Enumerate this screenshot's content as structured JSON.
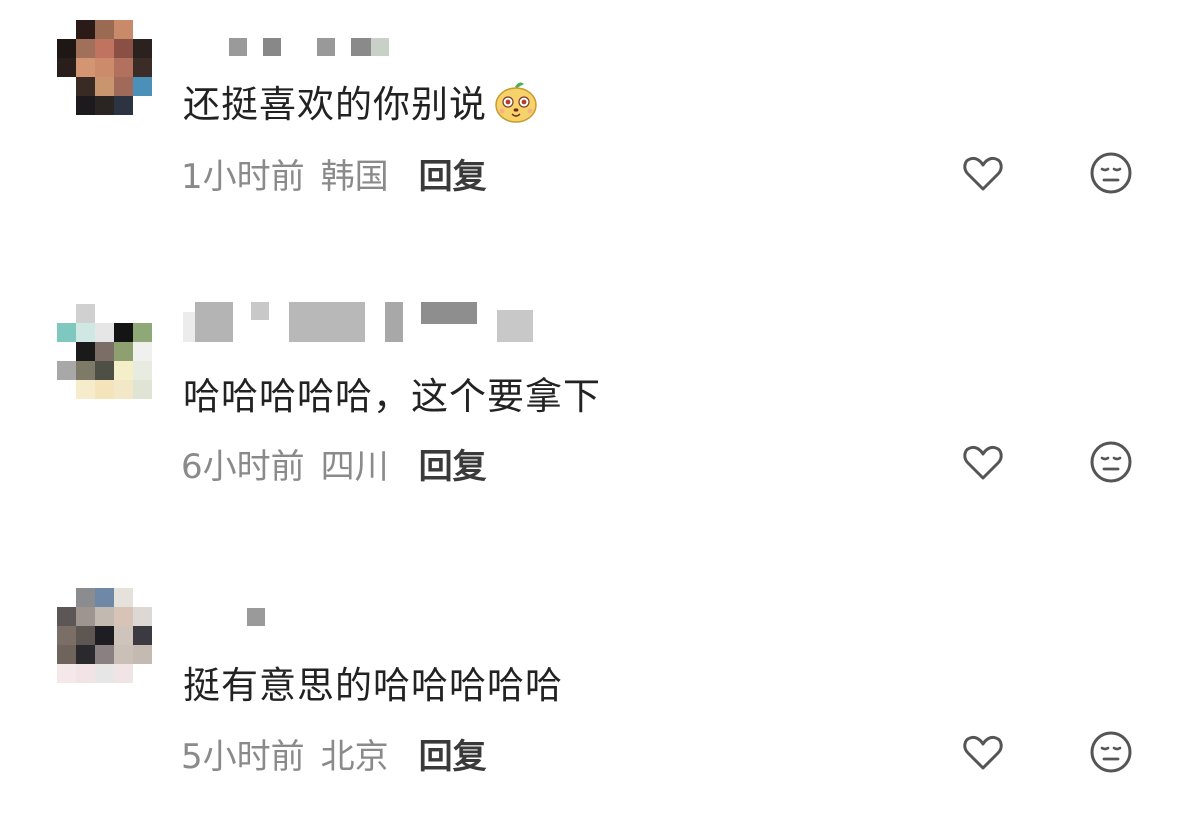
{
  "comments": [
    {
      "text": "还挺喜欢的你别说",
      "emoji": "smiley-sticker",
      "time": "1小时前",
      "location": "韩国",
      "reply_label": "回复",
      "like_icon": "heart-outline-icon",
      "dislike_icon": "meh-face-icon"
    },
    {
      "text": "哈哈哈哈哈，这个要拿下",
      "time": "6小时前",
      "location": "四川",
      "reply_label": "回复",
      "like_icon": "heart-outline-icon",
      "dislike_icon": "meh-face-icon"
    },
    {
      "text": "挺有意思的哈哈哈哈哈",
      "time": "5小时前",
      "location": "北京",
      "reply_label": "回复",
      "like_icon": "heart-outline-icon",
      "dislike_icon": "meh-face-icon"
    }
  ],
  "colors": {
    "text": "#222222",
    "meta": "#8a8a8a",
    "reply": "#3a3a3a",
    "icon": "#555555"
  }
}
